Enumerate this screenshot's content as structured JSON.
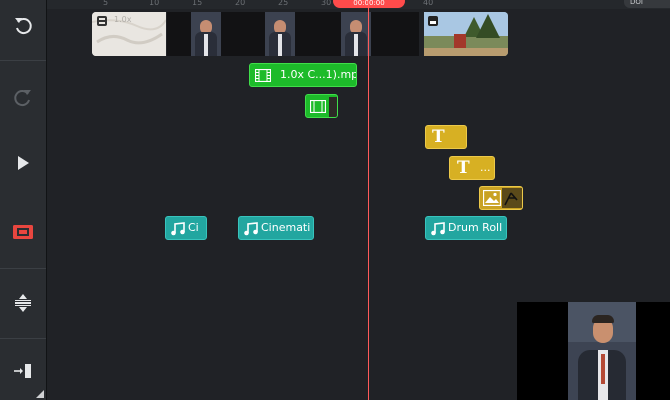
{
  "toolbar": {
    "items": [
      {
        "name": "undo",
        "icon": "undo-icon"
      },
      {
        "name": "redo",
        "icon": "redo-icon"
      },
      {
        "name": "play",
        "icon": "play-icon"
      },
      {
        "name": "preview-toggle",
        "icon": "screen-icon",
        "color": "#e8463f"
      },
      {
        "name": "adjust-layers",
        "icon": "expand-vertical-icon"
      },
      {
        "name": "export",
        "icon": "export-icon"
      }
    ]
  },
  "ruler": {
    "ticks": [
      "5",
      "10",
      "15",
      "20",
      "25",
      "30",
      "35",
      "40"
    ],
    "playhead_time": "00:00:00"
  },
  "top_right_badge": "DOI",
  "main_track": {
    "first_clip_label": "1.0x"
  },
  "layers": {
    "video_clip_label": "1.0x C...1).mp4",
    "text_clip_1_icon": "T",
    "text_clip_2_icon": "T",
    "text_clip_2_label": "...",
    "audio_clips": [
      {
        "label": "Ci"
      },
      {
        "label": "Cinemati"
      },
      {
        "label": "Drum Roll"
      }
    ]
  },
  "colors": {
    "video_layer": "#1dbb2a",
    "audio_layer": "#22a6a0",
    "text_layer": "#d7b023",
    "playhead": "#ff5a5a"
  }
}
